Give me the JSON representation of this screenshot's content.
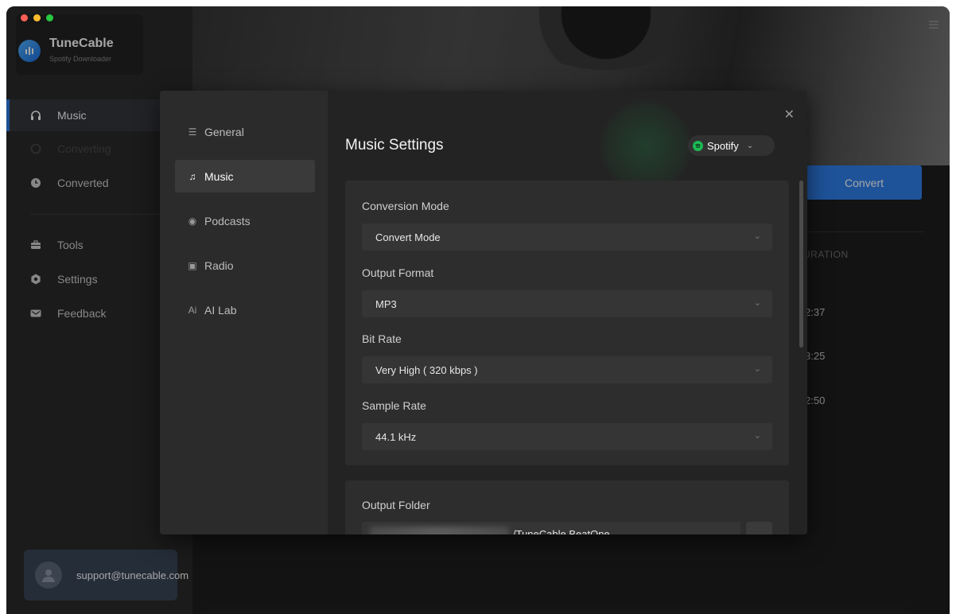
{
  "app": {
    "name": "TuneCable",
    "subtitle": "Spotify Downloader"
  },
  "sidebar": {
    "items": [
      {
        "label": "Music",
        "icon": "headphones-icon",
        "active": true
      },
      {
        "label": "Converting",
        "icon": "converting-icon",
        "disabled": true
      },
      {
        "label": "Converted",
        "icon": "clock-icon"
      },
      {
        "label": "Tools",
        "icon": "toolbox-icon"
      },
      {
        "label": "Settings",
        "icon": "gear-icon"
      },
      {
        "label": "Feedback",
        "icon": "mail-icon"
      }
    ],
    "account": {
      "email": "support@tunecable.com"
    }
  },
  "main": {
    "convert_label": "Convert",
    "duration_header": "URATION",
    "durations": [
      "2:37",
      "3:25",
      "2:50"
    ]
  },
  "dialog": {
    "tabs": [
      {
        "label": "General",
        "icon": "sliders-icon"
      },
      {
        "label": "Music",
        "icon": "music-note-icon",
        "active": true
      },
      {
        "label": "Podcasts",
        "icon": "podcast-icon"
      },
      {
        "label": "Radio",
        "icon": "radio-icon"
      },
      {
        "label": "AI Lab",
        "icon": "ai-icon"
      }
    ],
    "title": "Music Settings",
    "source": "Spotify",
    "fields": {
      "conversion_mode": {
        "label": "Conversion Mode",
        "value": "Convert Mode"
      },
      "output_format": {
        "label": "Output Format",
        "value": "MP3"
      },
      "bit_rate": {
        "label": "Bit Rate",
        "value": "Very High ( 320 kbps )"
      },
      "sample_rate": {
        "label": "Sample Rate",
        "value": "44.1 kHz"
      }
    },
    "output_folder": {
      "label": "Output Folder",
      "value": "/TuneCable BeatOne",
      "browse_label": "..."
    }
  },
  "colors": {
    "accent": "#2f80ed",
    "spotify": "#1db954",
    "light_red": "#ff5f57",
    "light_yellow": "#febc2e",
    "light_green": "#28c840"
  }
}
